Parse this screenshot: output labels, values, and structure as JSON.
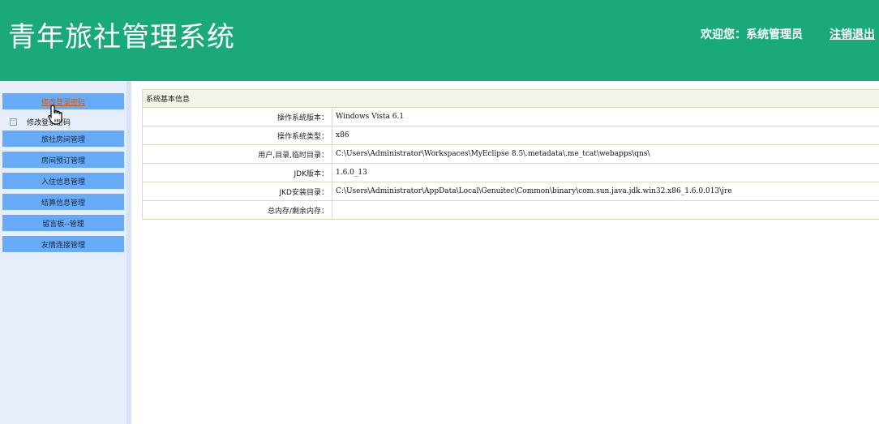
{
  "header": {
    "title": "青年旅社管理系统",
    "welcome_text": "欢迎您：系统管理员",
    "logout_label": "注销退出"
  },
  "sidebar": {
    "items": [
      {
        "label": "修改登录密码"
      },
      {
        "label": "旅社房间管理"
      },
      {
        "label": "房间预订管理"
      },
      {
        "label": "入住信息管理"
      },
      {
        "label": "结算信息管理"
      },
      {
        "label": "留言板--管理"
      },
      {
        "label": "友情连接管理"
      }
    ],
    "sub_item": {
      "label": "修改登录密码"
    }
  },
  "main": {
    "section_title": "系统基本信息",
    "rows": [
      {
        "label": "操作系统版本：",
        "value": "Windows Vista  6.1"
      },
      {
        "label": "操作系统类型：",
        "value": "x86"
      },
      {
        "label": "用户,目录,临时目录：",
        "value": "C:\\Users\\Administrator\\Workspaces\\MyEclipse 8.5\\.metadata\\.me_tcat\\webapps\\qns\\"
      },
      {
        "label": "JDK版本：",
        "value": "1.6.0_13"
      },
      {
        "label": "JKD安装目录：",
        "value": "C:\\Users\\Administrator\\AppData\\Local\\Genuitec\\Common\\binary\\com.sun.java.jdk.win32.x86_1.6.0.013\\jre"
      },
      {
        "label": "总内存/剩余内存：",
        "value": ""
      }
    ]
  },
  "colors": {
    "header_bg": "#1aaa7a",
    "sidebar_bg": "#e6eefc",
    "menu_button_bg": "#66aaf8",
    "active_link": "#e05500",
    "table_border": "#d8dcb8"
  }
}
